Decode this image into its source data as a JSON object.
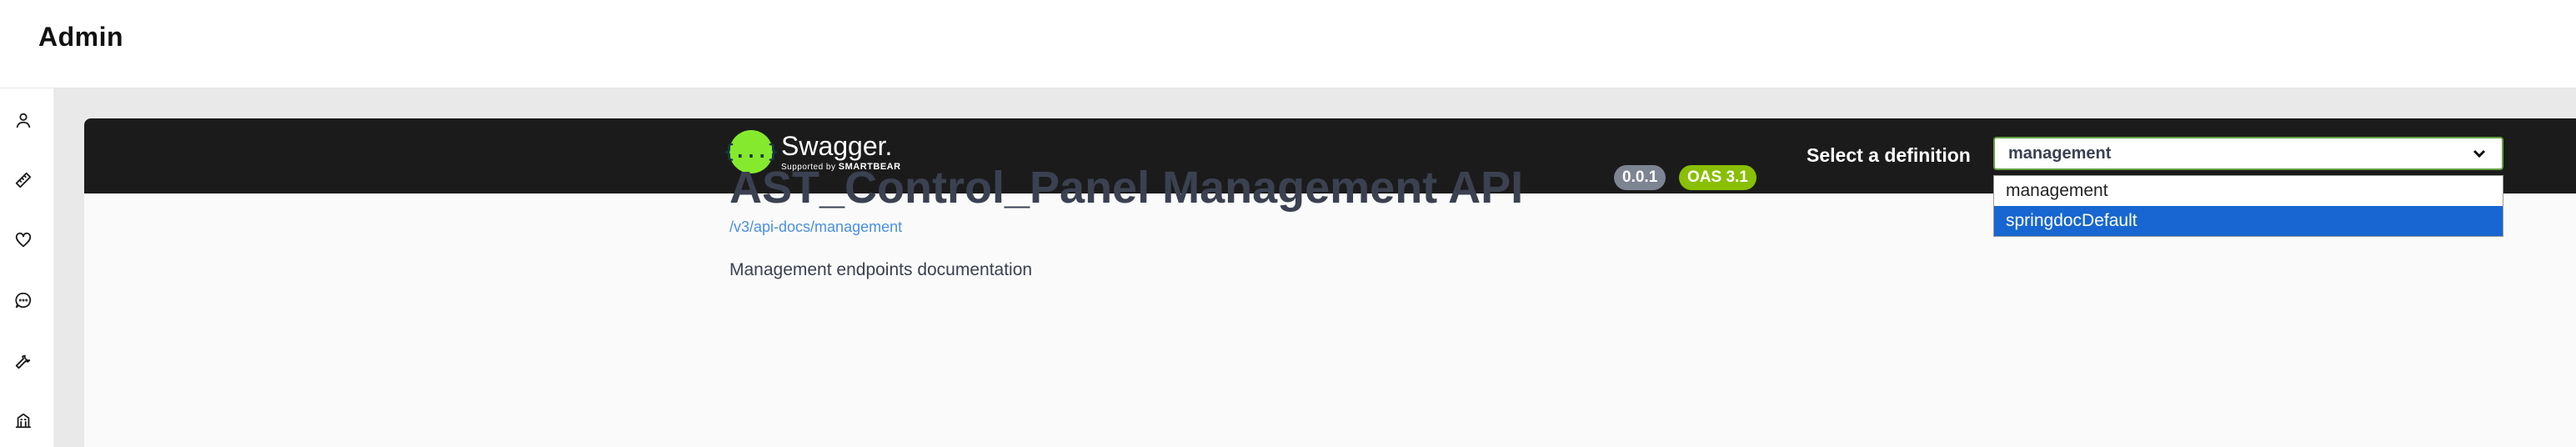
{
  "header": {
    "title": "Admin"
  },
  "sidebar": {
    "icons": [
      {
        "name": "user-icon"
      },
      {
        "name": "ruler-icon"
      },
      {
        "name": "heart-icon"
      },
      {
        "name": "chat-icon"
      },
      {
        "name": "wrench-icon"
      },
      {
        "name": "building-icon"
      }
    ]
  },
  "swagger": {
    "logo_glyph": "{...}",
    "logo_name": "Swagger.",
    "logo_supported": "Supported by",
    "logo_company": "SMARTBEAR",
    "select_label": "Select a definition",
    "selected_value": "management",
    "options": [
      "management",
      "springdocDefault"
    ],
    "highlighted_option": "springdocDefault"
  },
  "api": {
    "title": "AST_Control_Panel Management API",
    "version_badge": "0.0.1",
    "oas_badge": "OAS 3.1",
    "url": "/v3/api-docs/management",
    "description": "Management endpoints documentation"
  },
  "colors": {
    "swagger_bar": "#1b1b1b",
    "logo_green": "#85ea2d",
    "select_border": "#62a03f",
    "highlight_blue": "#1766d1",
    "version_badge": "#7d8492",
    "oas_badge": "#89bf04",
    "link": "#4990e2"
  }
}
